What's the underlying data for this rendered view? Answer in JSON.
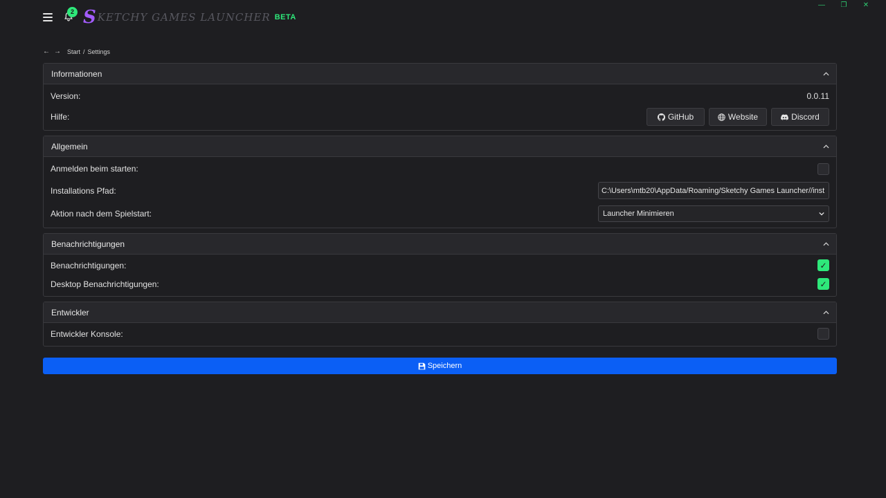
{
  "app": {
    "logo_letter": "S",
    "logo_rest": "KETCHY GAMES LAUNCHER",
    "beta": "BETA",
    "notification_count": "2"
  },
  "breadcrumb": {
    "start": "Start",
    "separator": "/",
    "current": "Settings"
  },
  "panels": {
    "info": {
      "title": "Informationen",
      "version_label": "Version:",
      "version_value": "0.0.11",
      "help_label": "Hilfe:",
      "github": "GitHub",
      "website": "Website",
      "discord": "Discord"
    },
    "general": {
      "title": "Allgemein",
      "login_label": "Anmelden beim starten:",
      "login_checked": false,
      "path_label": "Installations Pfad:",
      "path_value": "C:\\Users\\mtb20\\AppData/Roaming/Sketchy Games Launcher//inst",
      "action_label": "Aktion nach dem Spielstart:",
      "action_value": "Launcher Minimieren"
    },
    "notifications": {
      "title": "Benachrichtigungen",
      "notif_label": "Benachrichtigungen:",
      "notif_checked": true,
      "desktop_label": "Desktop Benachrichtigungen:",
      "desktop_checked": true
    },
    "developer": {
      "title": "Entwickler",
      "console_label": "Entwickler Konsole:",
      "console_checked": false
    }
  },
  "save_label": "Speichern",
  "colors": {
    "accent_green": "#2ee87a",
    "save_blue": "#0b5ff5",
    "logo_purple": "#a35cff",
    "background": "#1e1e21"
  }
}
